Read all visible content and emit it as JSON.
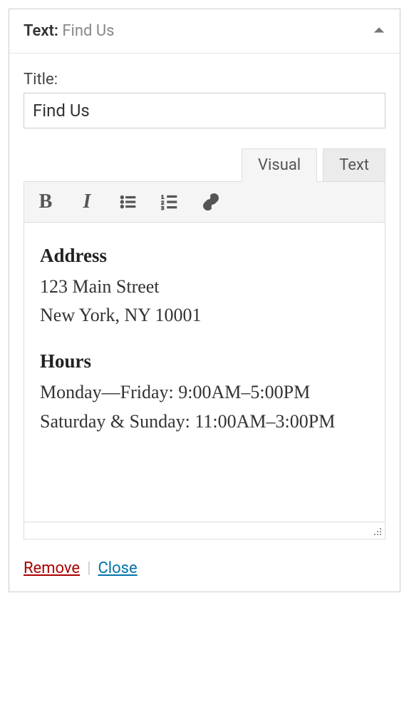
{
  "header": {
    "type_label": "Text:",
    "name": "Find Us"
  },
  "title": {
    "label": "Title:",
    "value": "Find Us"
  },
  "editor": {
    "tabs": {
      "visual": "Visual",
      "text": "Text"
    },
    "toolbar": {
      "bold": "B",
      "italic": "I"
    },
    "content": {
      "address_heading": "Address",
      "address_line1": "123 Main Street",
      "address_line2": "New York, NY 10001",
      "hours_heading": "Hours",
      "hours_line1": "Monday—Friday: 9:00AM–5:00PM",
      "hours_line2": "Saturday & Sunday: 11:00AM–3:00PM"
    }
  },
  "footer": {
    "remove": "Remove",
    "separator": "|",
    "close": "Close"
  }
}
